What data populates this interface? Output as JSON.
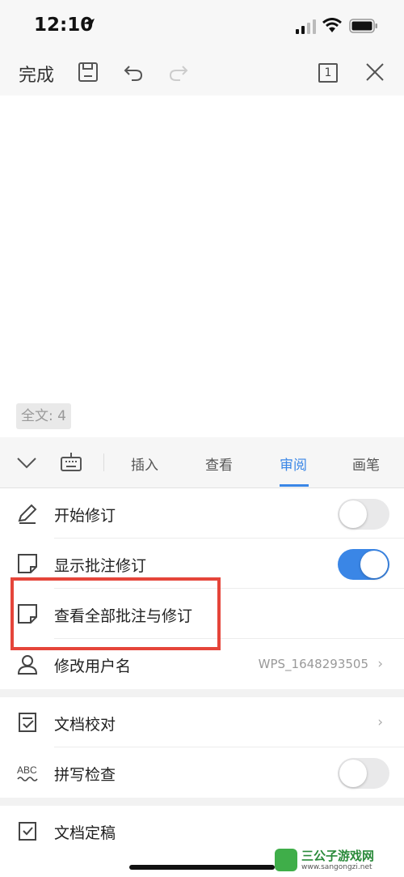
{
  "status_bar": {
    "time": "12:10"
  },
  "toolbar": {
    "done_label": "完成",
    "page_number": "1"
  },
  "document": {
    "word_count": "全文: 4"
  },
  "tabs": [
    {
      "label": "插入",
      "active": false
    },
    {
      "label": "查看",
      "active": false
    },
    {
      "label": "审阅",
      "active": true
    },
    {
      "label": "画笔",
      "active": false
    }
  ],
  "review_menu": {
    "start_revision": {
      "label": "开始修订",
      "toggle_on": false
    },
    "show_comments": {
      "label": "显示批注修订",
      "toggle_on": true
    },
    "view_all_comments": {
      "label": "查看全部批注与修订"
    },
    "change_username": {
      "label": "修改用户名",
      "value": "WPS_1648293505"
    },
    "proofread": {
      "label": "文档校对"
    },
    "spell_check": {
      "label": "拼写检查",
      "toggle_on": false
    },
    "finalize": {
      "label": "文档定稿"
    }
  },
  "watermark": {
    "title": "三公子游戏网",
    "url": "www.sangongzi.net"
  },
  "colors": {
    "accent": "#3a86e6",
    "highlight": "#e5453a"
  }
}
